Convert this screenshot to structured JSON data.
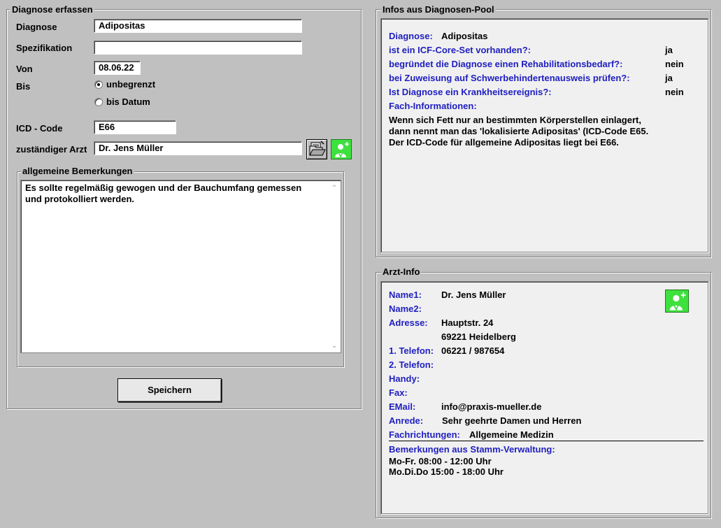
{
  "diagnose_erfassen": {
    "legend": "Diagnose erfassen",
    "diagnose_label": "Diagnose",
    "diagnose_value": "Adipositas",
    "spezifikation_label": "Spezifikation",
    "spezifikation_value": "",
    "von_label": "Von",
    "von_value": "08.06.22",
    "bis_label": "Bis",
    "bis_options": [
      {
        "label": "unbegrenzt",
        "selected": true
      },
      {
        "label": "bis Datum",
        "selected": false
      }
    ],
    "icd_label": "ICD - Code",
    "icd_value": "E66",
    "arzt_label": "zuständiger Arzt",
    "arzt_value": "Dr. Jens Müller",
    "bemerkungen_legend": "allgemeine Bemerkungen",
    "bemerkungen_text_1": "Es sollte regelmäßig gewogen und der Bauchumfang gemessen",
    "bemerkungen_text_2": "und protokolliert werden.",
    "save_label": "Speichern"
  },
  "diagnosen_pool": {
    "legend": "Infos aus Diagnosen-Pool",
    "diagnose_label": "Diagnose:",
    "diagnose_value": "Adipositas",
    "questions": [
      {
        "label": "ist ein ICF-Core-Set vorhanden?:",
        "value": "ja"
      },
      {
        "label": "begründet die Diagnose einen Rehabilitationsbedarf?:",
        "value": "nein"
      },
      {
        "label": "bei Zuweisung auf Schwerbehindertenausweis prüfen?:",
        "value": "ja"
      },
      {
        "label": "Ist Diagnose ein Krankheitsereignis?:",
        "value": "nein"
      }
    ],
    "fach_label": "Fach-Informationen:",
    "fach_lines": [
      "Wenn sich Fett nur an bestimmten Körperstellen einlagert,",
      "dann nennt man das 'lokalisierte Adipositas' (ICD-Code E65.",
      "Der ICD-Code für allgemeine Adipositas liegt bei E66."
    ]
  },
  "arzt_info": {
    "legend": "Arzt-Info",
    "name1_label": "Name1:",
    "name1_value": "Dr. Jens Müller",
    "name2_label": "Name2:",
    "adresse_label": "Adresse:",
    "adresse_line1": "Hauptstr. 24",
    "adresse_line2": "69221 Heidelberg",
    "telefon1_label": "1. Telefon:",
    "telefon1_value": "06221 / 987654",
    "telefon2_label": "2. Telefon:",
    "handy_label": "Handy:",
    "fax_label": "Fax:",
    "email_label": "EMail:",
    "email_value": "info@praxis-mueller.de",
    "anrede_label": "Anrede:",
    "anrede_value": "Sehr geehrte Damen und Herren",
    "fach_label": "Fachrichtungen:",
    "fach_value": "Allgemeine Medizin",
    "bemerkungen_label": "Bemerkungen aus Stamm-Verwaltung:",
    "bemerkungen_lines": [
      "Mo-Fr. 08:00 - 12:00 Uhr",
      "Mo.Di.Do 15:00 - 18:00 Uhr"
    ]
  },
  "icons": {
    "open_folder": "open-folder-icon",
    "doctor": "doctor-icon",
    "doctor_color": "#3ee03e"
  }
}
